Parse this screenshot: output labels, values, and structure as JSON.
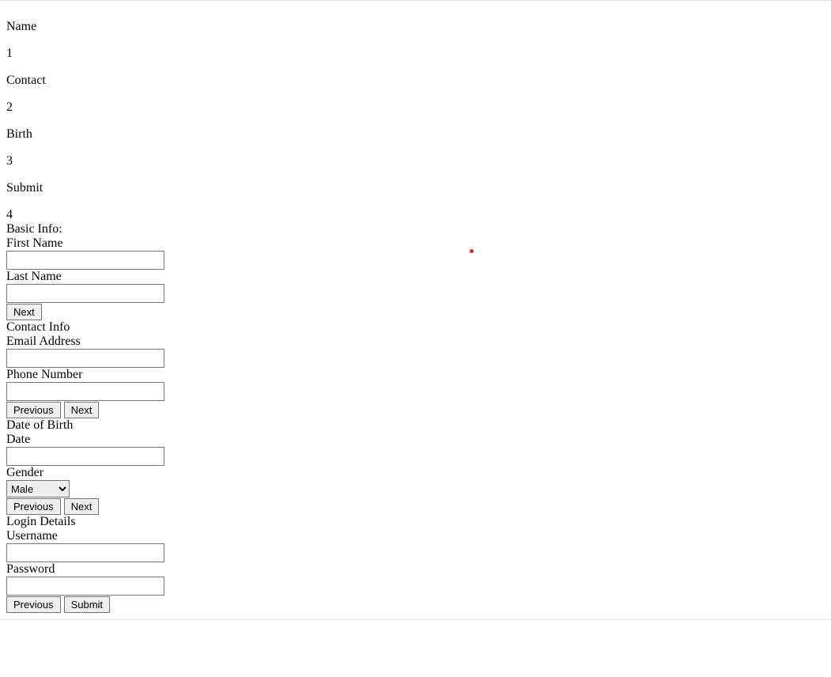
{
  "steps": [
    {
      "title": "Name",
      "number": "1"
    },
    {
      "title": "Contact",
      "number": "2"
    },
    {
      "title": "Birth",
      "number": "3"
    },
    {
      "title": "Submit",
      "number": "4"
    }
  ],
  "sections": {
    "basic": {
      "title": "Basic Info:",
      "first_name_label": "First Name",
      "last_name_label": "Last Name",
      "first_name_value": "",
      "last_name_value": ""
    },
    "contact": {
      "title": "Contact Info",
      "email_label": "Email Address",
      "phone_label": "Phone Number",
      "email_value": "",
      "phone_value": ""
    },
    "birth": {
      "title": "Date of Birth",
      "date_label": "Date",
      "gender_label": "Gender",
      "date_value": "",
      "gender_selected": "Male"
    },
    "login": {
      "title": "Login Details",
      "username_label": "Username",
      "password_label": "Password",
      "username_value": "",
      "password_value": ""
    }
  },
  "buttons": {
    "next": "Next",
    "previous": "Previous",
    "submit": "Submit"
  }
}
